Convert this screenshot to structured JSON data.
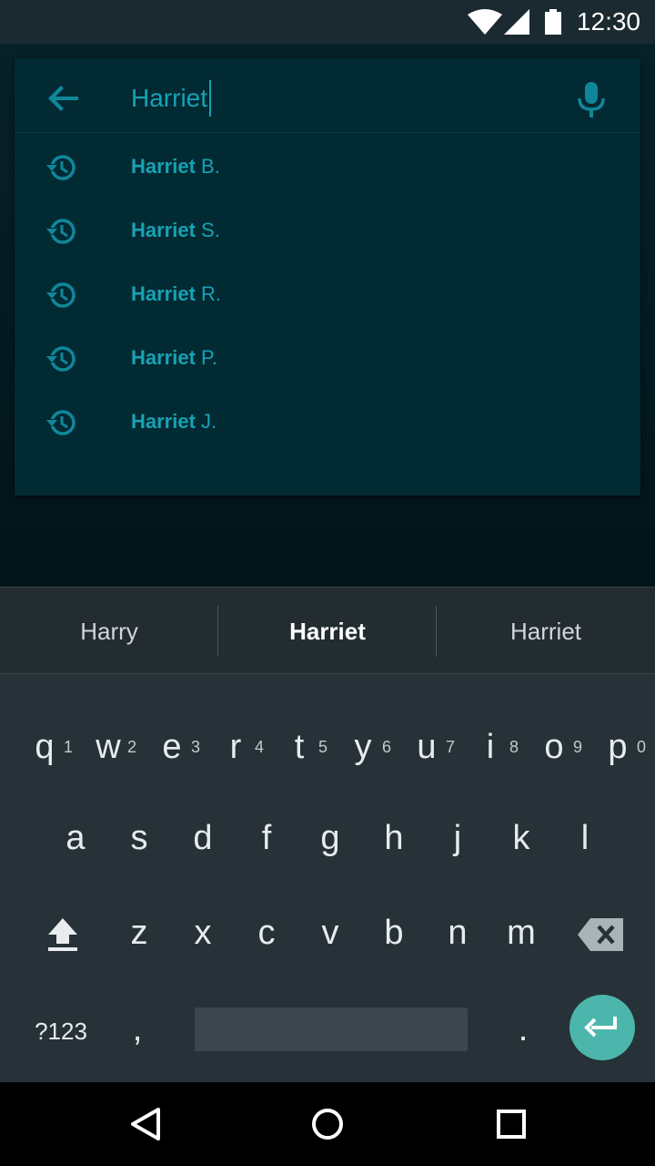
{
  "status_bar": {
    "time": "12:30",
    "icons": [
      "wifi-icon",
      "signal-icon",
      "battery-icon"
    ]
  },
  "search": {
    "query": "Harriet",
    "back_icon": "arrow-back-icon",
    "mic_icon": "mic-icon",
    "suggestions": [
      {
        "bold": "Harriet",
        "rest": " B."
      },
      {
        "bold": "Harriet",
        "rest": " S."
      },
      {
        "bold": "Harriet",
        "rest": " R."
      },
      {
        "bold": "Harriet",
        "rest": " P."
      },
      {
        "bold": "Harriet",
        "rest": " J."
      }
    ]
  },
  "keyboard": {
    "suggestions": [
      "Harry",
      "Harriet",
      "Harriet"
    ],
    "row1": [
      {
        "key": "q",
        "hint": "1"
      },
      {
        "key": "w",
        "hint": "2"
      },
      {
        "key": "e",
        "hint": "3"
      },
      {
        "key": "r",
        "hint": "4"
      },
      {
        "key": "t",
        "hint": "5"
      },
      {
        "key": "y",
        "hint": "6"
      },
      {
        "key": "u",
        "hint": "7"
      },
      {
        "key": "i",
        "hint": "8"
      },
      {
        "key": "o",
        "hint": "9"
      },
      {
        "key": "p",
        "hint": "0"
      }
    ],
    "row2": [
      "a",
      "s",
      "d",
      "f",
      "g",
      "h",
      "j",
      "k",
      "l"
    ],
    "row3": [
      "z",
      "x",
      "c",
      "v",
      "b",
      "n",
      "m"
    ],
    "symbols_label": "?123",
    "comma": ",",
    "period": ".",
    "accent_color": "#4db6ac"
  },
  "colors": {
    "search_text": "#17a2b5",
    "card_bg": "#022a33",
    "keyboard_bg": "#263238"
  }
}
